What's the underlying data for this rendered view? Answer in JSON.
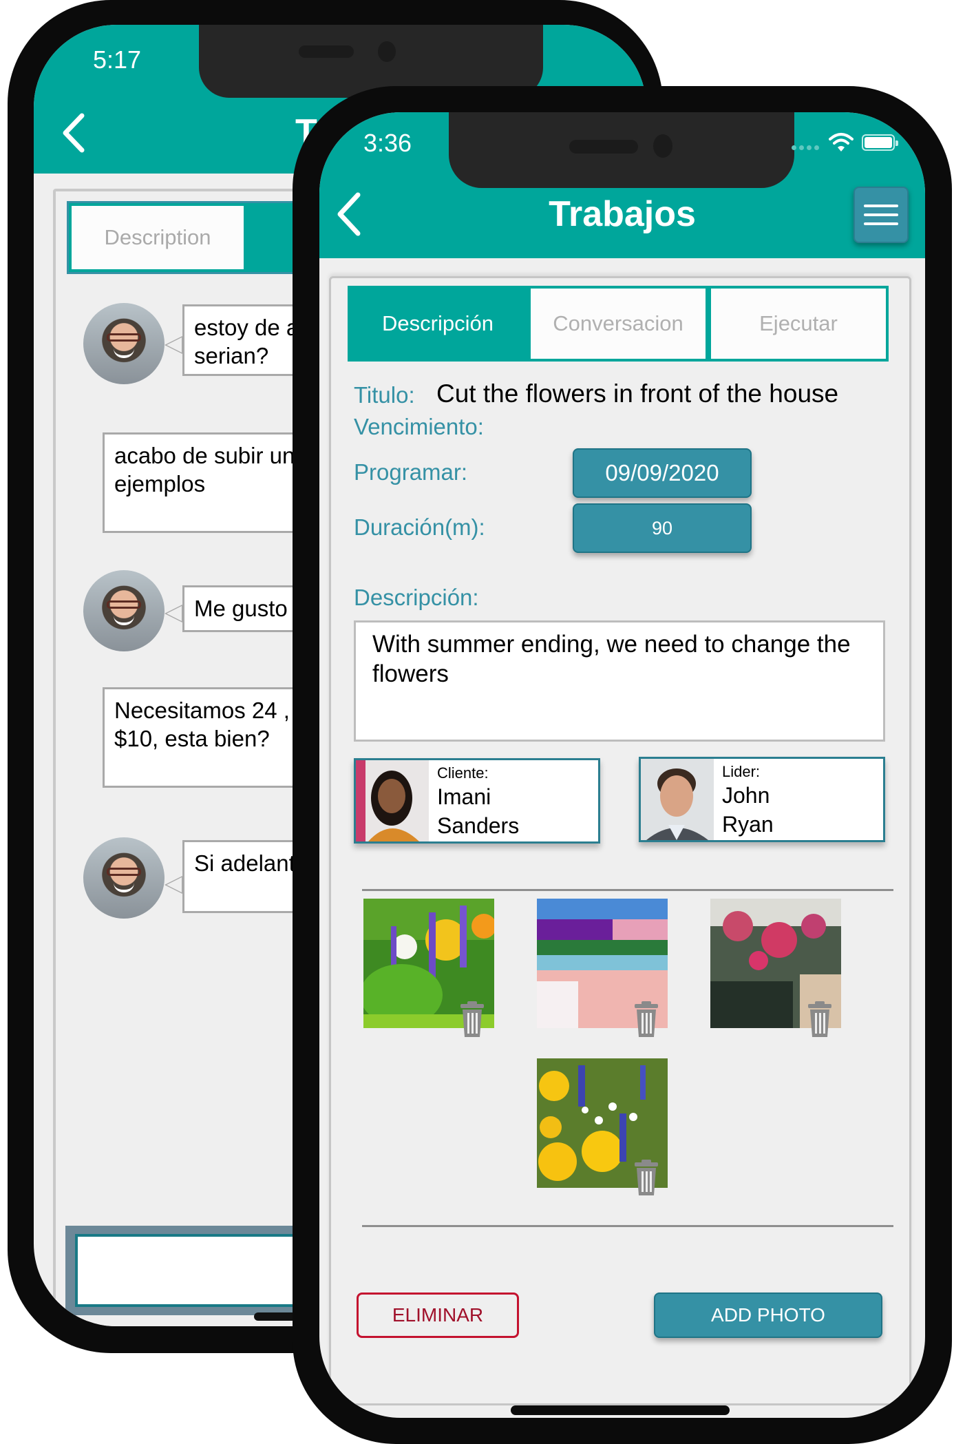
{
  "back_phone": {
    "status_time": "5:17",
    "header_title_partial": "T",
    "tabs": [
      {
        "label": "Description"
      }
    ],
    "messages": [
      {
        "text": "estoy de a\nserian?",
        "has_avatar": true
      },
      {
        "text": "acabo de subir un\nejemplos",
        "has_avatar": false
      },
      {
        "text": "Me gusto",
        "has_avatar": true
      },
      {
        "text": "Necesitamos 24 ,\n$10, esta bien?",
        "has_avatar": false
      },
      {
        "text": "Si adelante",
        "has_avatar": true
      }
    ],
    "message_input_value": ""
  },
  "front_phone": {
    "status_time": "3:36",
    "status_icons": [
      "signal-dots-icon",
      "wifi-icon",
      "battery-icon"
    ],
    "header": {
      "title": "Trabajos",
      "back_icon": "chevron-left-icon",
      "menu_icon": "hamburger-menu-icon"
    },
    "tabs": [
      {
        "label": "Descripción",
        "active": true
      },
      {
        "label": "Conversacion",
        "active": false
      },
      {
        "label": "Ejecutar",
        "active": false
      }
    ],
    "fields": {
      "titulo_label": "Titulo:",
      "titulo_value": "Cut the flowers in front of the house",
      "vencimiento_label": "Vencimiento:",
      "programar_label": "Programar:",
      "programar_value": "09/09/2020",
      "duracion_label": "Duración(m):",
      "duracion_value": "90",
      "descripcion_label": "Descripción:",
      "descripcion_value": "With summer ending, we need to change the flowers"
    },
    "people": [
      {
        "role": "Cliente:",
        "name": "Imani\nSanders"
      },
      {
        "role": "Lider:",
        "name": "John\nRyan"
      }
    ],
    "photos": [
      {
        "alt": "garden flower bed with purple, yellow and white flowers"
      },
      {
        "alt": "field of tulips and hyacinths"
      },
      {
        "alt": "pink bougainvillea over archway"
      },
      {
        "alt": "yellow daisies and blue delphinium"
      }
    ],
    "buttons": {
      "delete": "ELIMINAR",
      "add_photo": "ADD PHOTO"
    },
    "colors": {
      "primary": "#00a69b",
      "secondary": "#3591a5",
      "danger": "#c4122f",
      "background": "#efefef"
    }
  }
}
